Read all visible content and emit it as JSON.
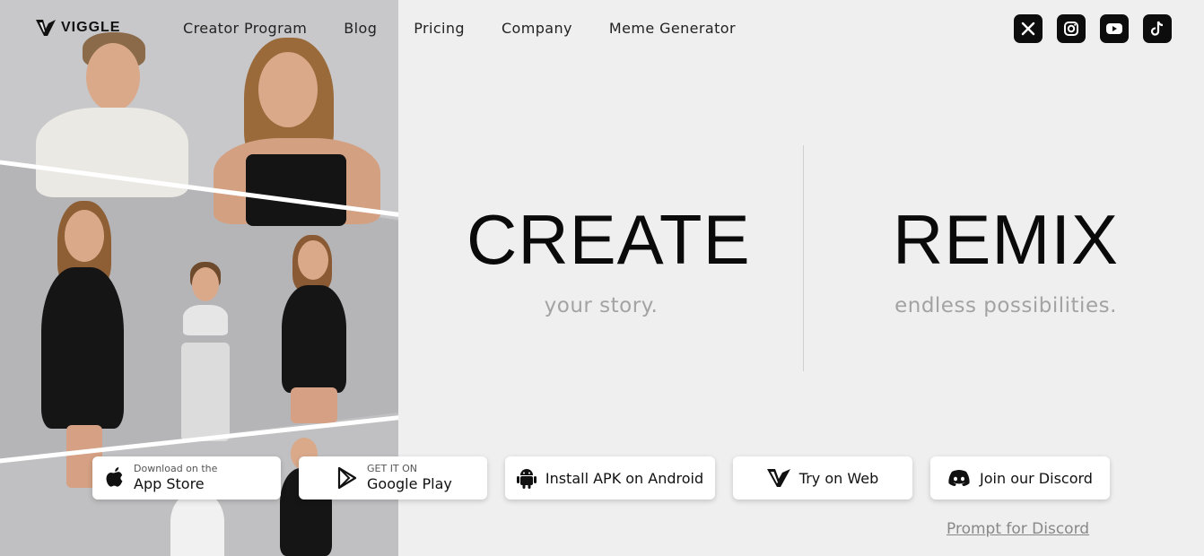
{
  "logo": {
    "text": "VIGGLE",
    "icon": "viggle-logo-icon"
  },
  "nav": {
    "items": [
      {
        "label": "Creator Program"
      },
      {
        "label": "Blog"
      },
      {
        "label": "Pricing"
      },
      {
        "label": "Company"
      },
      {
        "label": "Meme Generator"
      }
    ]
  },
  "socials": [
    {
      "name": "x-icon"
    },
    {
      "name": "instagram-icon"
    },
    {
      "name": "youtube-icon"
    },
    {
      "name": "tiktok-icon"
    }
  ],
  "hero": {
    "left": {
      "title": "CREATE",
      "subtitle": "your story."
    },
    "right": {
      "title": "REMIX",
      "subtitle": "endless possibilities."
    }
  },
  "buttons": {
    "app_store": {
      "small": "Download on the",
      "big": "App Store"
    },
    "google_play": {
      "small": "GET IT ON",
      "big": "Google Play"
    },
    "apk": {
      "label": "Install APK on Android"
    },
    "web": {
      "label": "Try on Web"
    },
    "discord": {
      "label": "Join our Discord"
    }
  },
  "links": {
    "prompt_discord": "Prompt for Discord"
  },
  "colors": {
    "page_bg": "#efefef",
    "text": "#0a0a0a",
    "muted": "#a3a3a3",
    "icon_bg": "#0d0d0d"
  }
}
